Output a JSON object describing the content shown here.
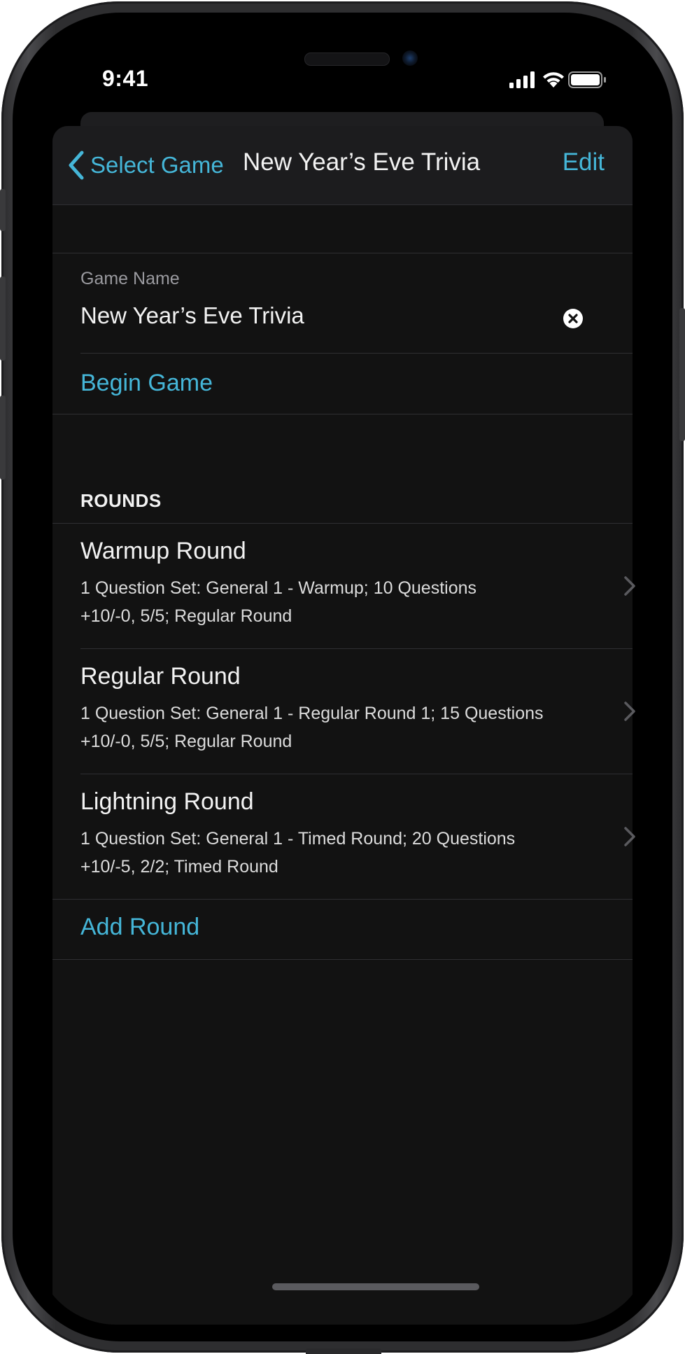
{
  "status_bar": {
    "time": "9:41",
    "signal_icon": "cellular-signal-icon",
    "wifi_icon": "wifi-icon",
    "battery_icon": "battery-icon"
  },
  "navbar": {
    "back_label": "Select Game",
    "back_icon": "chevron-left-icon",
    "title": "New Year’s Eve Trivia",
    "edit_label": "Edit"
  },
  "game_name": {
    "label": "Game Name",
    "value": "New Year’s Eve Trivia",
    "clear_icon": "clear-circle-icon"
  },
  "begin_game_label": "Begin Game",
  "rounds": {
    "header": "ROUNDS",
    "items": [
      {
        "title": "Warmup Round",
        "line1": "1 Question Set: General 1 - Warmup; 10 Questions",
        "line2": "+10/-0, 5/5; Regular Round"
      },
      {
        "title": "Regular Round",
        "line1": "1 Question Set: General 1 - Regular Round 1; 15 Questions",
        "line2": "+10/-0, 5/5; Regular Round"
      },
      {
        "title": "Lightning Round",
        "line1": "1 Question Set: General 1 - Timed Round; 20 Questions",
        "line2": "+10/-5, 2/2; Timed Round"
      }
    ],
    "add_label": "Add Round"
  },
  "colors": {
    "accent": "#45b6d8",
    "background": "#121212",
    "navbar": "#1c1c1e",
    "separator": "#2f2f32",
    "text_primary": "#f2f2f2",
    "text_secondary": "#9a9a9f"
  }
}
